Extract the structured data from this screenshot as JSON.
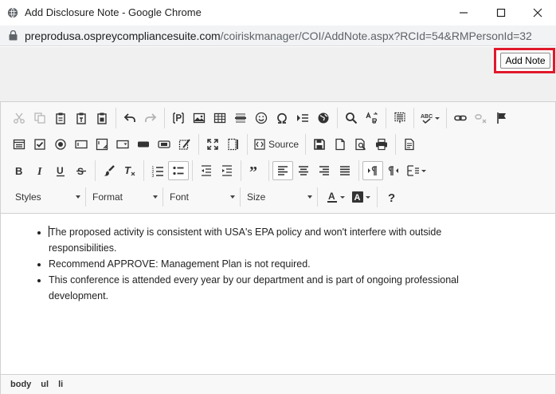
{
  "window": {
    "title": "Add Disclosure Note - Google Chrome"
  },
  "address_bar": {
    "host": "preprodusa.ospreycompliancesuite.com",
    "path": "/coiriskmanager/COI/AddNote.aspx?RCId=54&RMPersonId=32"
  },
  "header": {
    "add_note_label": "Add Note",
    "highlight_color": "#e0192b"
  },
  "toolbar": {
    "source_label": "Source",
    "combos": {
      "styles": "Styles",
      "format": "Format",
      "font": "Font",
      "size": "Size"
    }
  },
  "content": {
    "bullets": [
      "The proposed activity is consistent with USA's EPA policy and won't interfere with outside responsibilities.",
      "Recommend APPROVE: Management Plan is not required.",
      "This conference is attended every year by our department and is part of ongoing professional development."
    ]
  },
  "element_path": [
    "body",
    "ul",
    "li"
  ]
}
